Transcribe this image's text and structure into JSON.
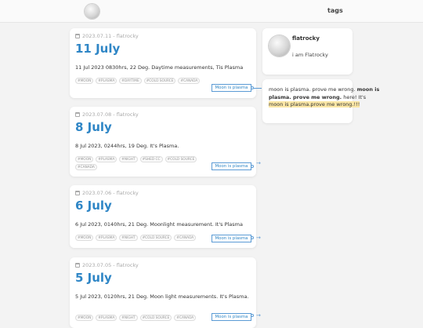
{
  "header": {
    "nav_tags": "tags"
  },
  "posts": [
    {
      "meta": "2023.07.11 - flatrocky",
      "title": "11 July",
      "excerpt": "11 Jul 2023 0830hrs, 22 Deg. Daytime measurements, Tis Plasma",
      "tags": [
        "#MOON",
        "#PLASMA",
        "#DAYTIME",
        "#COLD SOURCE",
        "#CANADA"
      ],
      "link": "Moon is plasma"
    },
    {
      "meta": "2023.07.08 - flatrocky",
      "title": "8 July",
      "excerpt": "8 Jul 2023, 0244hrs, 19 Deg. It's Plasma.",
      "tags": [
        "#MOON",
        "#PLASMA",
        "#NIGHT",
        "#SHED CC",
        "#COLD SOURCE",
        "#CANADA"
      ],
      "link": "Moon is plasma"
    },
    {
      "meta": "2023.07.06 - flatrocky",
      "title": "6 July",
      "excerpt": "6 Jul 2023, 0140hrs, 21 Deg. Moonlight measurement. It's Plasma",
      "tags": [
        "#MOON",
        "#PLASMA",
        "#NIGHT",
        "#COLD SOURCE",
        "#CANADA"
      ],
      "link": "Moon is plasma"
    },
    {
      "meta": "2023.07.05 - flatrocky",
      "title": "5 July",
      "excerpt": "5 Jul 2023, 0120hrs, 21 Deg. Moon light measurements. It's Plasma.",
      "tags": [
        "#MOON",
        "#PLASMA",
        "#NIGHT",
        "#COLD SOURCE",
        "#CANADA"
      ],
      "link": "Moon is plasma"
    }
  ],
  "profile": {
    "name": "flatrocky",
    "bio": "i am Flatrocky"
  },
  "note": {
    "t1": "moon is plasma. prove me wrong. ",
    "t2": "moon is plasma. prove me wrong.",
    "t3": " here! It's ",
    "t4": "moon is plasma.prove me wrong.!!!"
  },
  "colors": {
    "accent": "#2f86c6",
    "highlight": "#fbe7a6",
    "link_border": "#5b9bd5"
  },
  "icons": {
    "post_meta": "calendar-icon",
    "arrow": "arrow-right-icon"
  }
}
